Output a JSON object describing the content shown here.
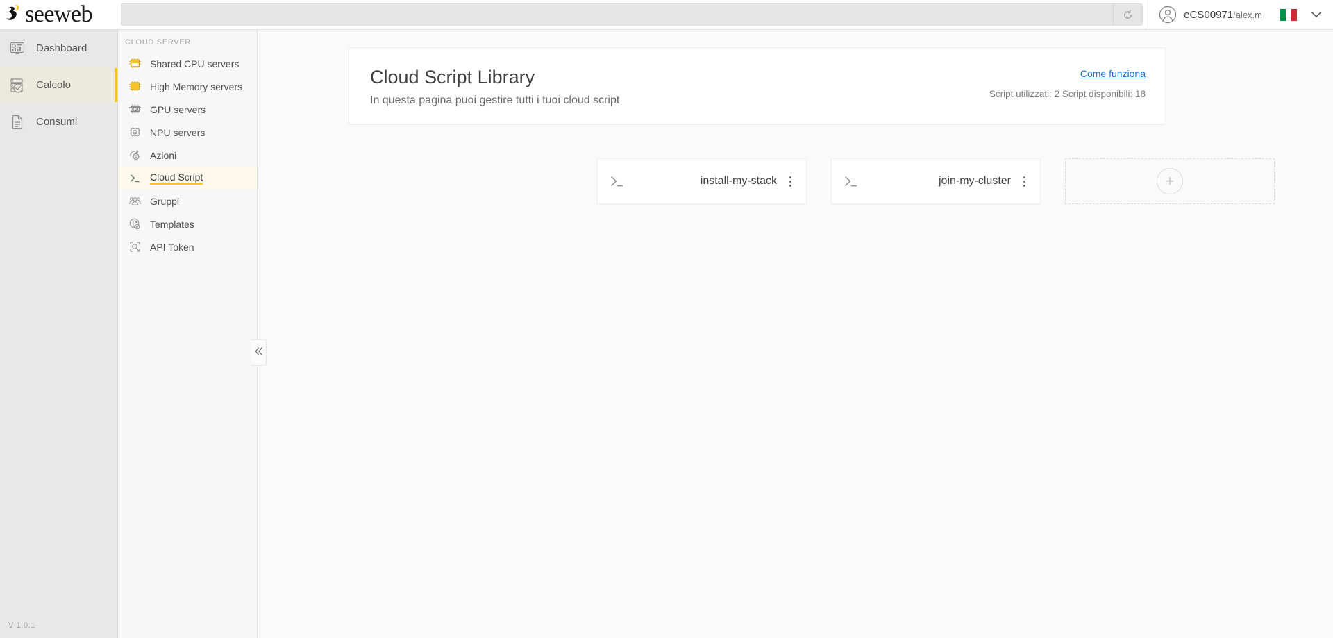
{
  "header": {
    "logo_text": "seeweb",
    "search": {
      "value": "",
      "placeholder": ""
    },
    "refresh_icon": "refresh-icon",
    "user": {
      "avatar_icon": "user-avatar-icon",
      "account": "eCS00971",
      "separator": "/",
      "username": "alex.m"
    },
    "language": {
      "flag": "italy-flag",
      "chevron_icon": "chevron-down-icon"
    }
  },
  "sidebar_primary": {
    "items": [
      {
        "label": "Dashboard",
        "icon": "dashboard-icon",
        "active": false
      },
      {
        "label": "Calcolo",
        "icon": "server-check-icon",
        "active": true
      },
      {
        "label": "Consumi",
        "icon": "document-icon",
        "active": false
      }
    ],
    "version": "V 1.0.1"
  },
  "sidebar_secondary": {
    "section_title": "CLOUD SERVER",
    "collapse_icon": "double-chevron-left-icon",
    "items": [
      {
        "label": "Shared CPU servers",
        "icon": "cpu-chip-icon",
        "active": false
      },
      {
        "label": "High Memory servers",
        "icon": "memory-chip-icon",
        "active": false
      },
      {
        "label": "GPU servers",
        "icon": "gpu-chip-icon",
        "active": false
      },
      {
        "label": "NPU servers",
        "icon": "npu-chip-icon",
        "active": false
      },
      {
        "label": "Azioni",
        "icon": "actions-gear-icon",
        "active": false
      },
      {
        "label": "Cloud Script",
        "icon": "terminal-prompt-icon",
        "active": true
      },
      {
        "label": "Gruppi",
        "icon": "group-users-icon",
        "active": false
      },
      {
        "label": "Templates",
        "icon": "templates-icon",
        "active": false
      },
      {
        "label": "API Token",
        "icon": "api-token-icon",
        "active": false
      }
    ]
  },
  "main": {
    "page_title": "Cloud Script Library",
    "page_subtitle": "In questa pagina puoi gestire tutti i tuoi cloud script",
    "how_it_works_label": "Come funziona",
    "quota_text": "Script utilizzati: 2 Script disponibili: 18",
    "scripts": [
      {
        "name": "install-my-stack",
        "icon": "terminal-prompt-icon",
        "menu_icon": "kebab-menu-icon"
      },
      {
        "name": "join-my-cluster",
        "icon": "terminal-prompt-icon",
        "menu_icon": "kebab-menu-icon"
      }
    ],
    "add_card": {
      "icon": "plus-circle-icon",
      "symbol": "+"
    }
  },
  "colors": {
    "accent_yellow": "#f5c518",
    "link_blue": "#1a6fd4",
    "flag_green": "#009246",
    "flag_white": "#ffffff",
    "flag_red": "#ce2b37"
  }
}
